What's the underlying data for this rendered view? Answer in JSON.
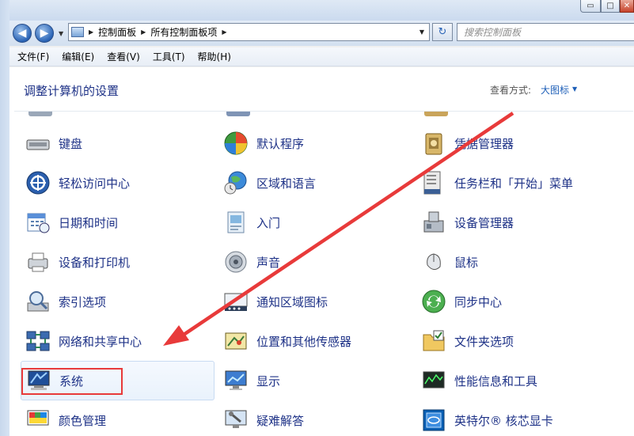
{
  "window": {
    "controls": {
      "minimize": "▭",
      "maximize": "□",
      "close": "✕"
    }
  },
  "nav": {
    "back": "◀",
    "forward": "▶",
    "breadcrumbs": [
      "控制面板",
      "所有控制面板项"
    ],
    "search_placeholder": "搜索控制面板"
  },
  "menu": [
    "文件(F)",
    "编辑(E)",
    "查看(V)",
    "工具(T)",
    "帮助(H)"
  ],
  "content": {
    "title": "调整计算机的设置",
    "view_by_label": "查看方式:",
    "view_by_value": "大图标"
  },
  "items": [
    {
      "label": "键盘",
      "icon": "keyboard-icon"
    },
    {
      "label": "默认程序",
      "icon": "default-programs-icon"
    },
    {
      "label": "凭据管理器",
      "icon": "credential-manager-icon"
    },
    {
      "label": "轻松访问中心",
      "icon": "ease-of-access-icon"
    },
    {
      "label": "区域和语言",
      "icon": "region-language-icon"
    },
    {
      "label": "任务栏和「开始」菜单",
      "icon": "taskbar-start-icon"
    },
    {
      "label": "日期和时间",
      "icon": "date-time-icon"
    },
    {
      "label": "入门",
      "icon": "getting-started-icon"
    },
    {
      "label": "设备管理器",
      "icon": "device-manager-icon"
    },
    {
      "label": "设备和打印机",
      "icon": "devices-printers-icon"
    },
    {
      "label": "声音",
      "icon": "sound-icon"
    },
    {
      "label": "鼠标",
      "icon": "mouse-icon"
    },
    {
      "label": "索引选项",
      "icon": "indexing-options-icon"
    },
    {
      "label": "通知区域图标",
      "icon": "notification-icons-icon"
    },
    {
      "label": "同步中心",
      "icon": "sync-center-icon"
    },
    {
      "label": "网络和共享中心",
      "icon": "network-sharing-icon"
    },
    {
      "label": "位置和其他传感器",
      "icon": "location-sensors-icon"
    },
    {
      "label": "文件夹选项",
      "icon": "folder-options-icon"
    },
    {
      "label": "系统",
      "icon": "system-icon"
    },
    {
      "label": "显示",
      "icon": "display-icon"
    },
    {
      "label": "性能信息和工具",
      "icon": "performance-icon"
    },
    {
      "label": "颜色管理",
      "icon": "color-management-icon"
    },
    {
      "label": "疑难解答",
      "icon": "troubleshooting-icon"
    },
    {
      "label": "英特尔® 核芯显卡",
      "icon": "intel-graphics-icon"
    }
  ],
  "colors": {
    "link": "#1e3287",
    "annotation_red": "#e83a3a"
  }
}
